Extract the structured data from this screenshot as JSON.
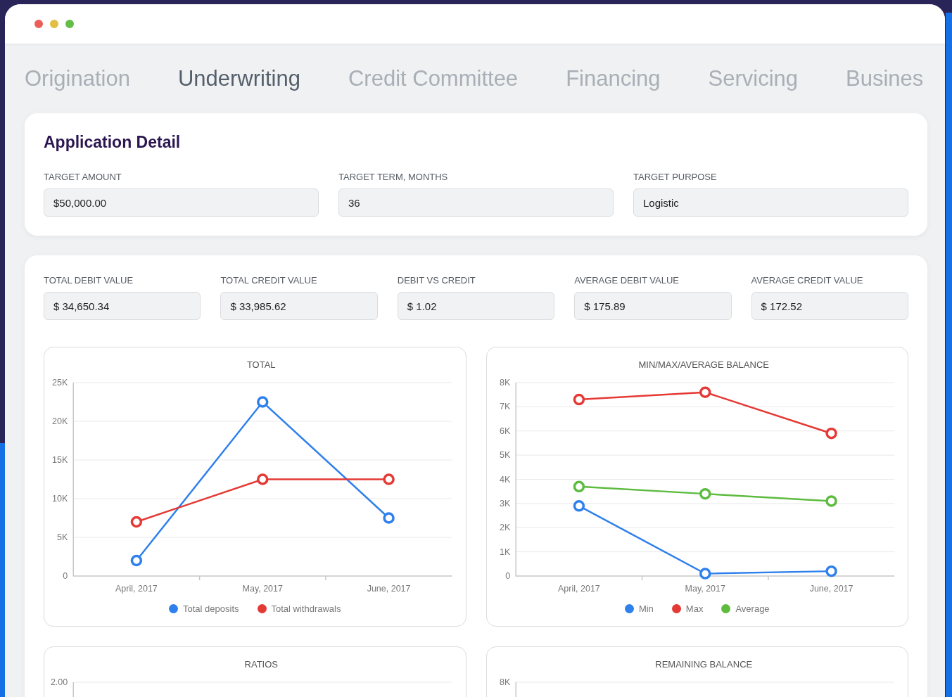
{
  "window_controls": [
    {
      "color": "#ec5f58"
    },
    {
      "color": "#e2bf40"
    },
    {
      "color": "#64bd46"
    }
  ],
  "tabs": [
    {
      "label": "Origination",
      "selected": false
    },
    {
      "label": "Underwriting",
      "selected": true
    },
    {
      "label": "Credit Committee",
      "selected": false
    },
    {
      "label": "Financing",
      "selected": false
    },
    {
      "label": "Servicing",
      "selected": false
    },
    {
      "label": "Busines",
      "selected": false
    }
  ],
  "application_detail": {
    "title": "Application Detail",
    "fields": [
      {
        "label": "TARGET AMOUNT",
        "value": "$50,000.00"
      },
      {
        "label": "TARGET TERM, MONTHS",
        "value": "36"
      },
      {
        "label": "TARGET PURPOSE",
        "value": "Logistic"
      }
    ]
  },
  "summary": {
    "fields": [
      {
        "label": "TOTAL DEBIT VALUE",
        "value": "$ 34,650.34"
      },
      {
        "label": "TOTAL CREDIT VALUE",
        "value": "$ 33,985.62"
      },
      {
        "label": "DEBIT VS CREDIT",
        "value": "$ 1.02"
      },
      {
        "label": "AVERAGE DEBIT VALUE",
        "value": "$ 175.89"
      },
      {
        "label": "AVERAGE CREDIT VALUE",
        "value": "$ 172.52"
      }
    ]
  },
  "charts": [
    {
      "chart_data": {
        "type": "line",
        "title": "TOTAL",
        "grid": true,
        "legend": "bottom",
        "categories": [
          "April, 2017",
          "May, 2017",
          "June, 2017"
        ],
        "ylim": [
          0,
          25000
        ],
        "yticks": [
          {
            "value": 0,
            "label": "0"
          },
          {
            "value": 5000,
            "label": "5K"
          },
          {
            "value": 10000,
            "label": "10K"
          },
          {
            "value": 15000,
            "label": "15K"
          },
          {
            "value": 20000,
            "label": "20K"
          },
          {
            "value": 25000,
            "label": "25K"
          }
        ],
        "series": [
          {
            "name": "Total deposits",
            "color": "#2f80ed",
            "marker": "circle",
            "values": [
              2000,
              22500,
              7500
            ]
          },
          {
            "name": "Total withdrawals",
            "color": "#e53935",
            "marker": "circle",
            "values": [
              7000,
              12500,
              12500
            ]
          }
        ]
      }
    },
    {
      "chart_data": {
        "type": "line",
        "title": "MIN/MAX/AVERAGE BALANCE",
        "grid": true,
        "legend": "bottom",
        "categories": [
          "April, 2017",
          "May, 2017",
          "June, 2017"
        ],
        "ylim": [
          0,
          8000
        ],
        "yticks": [
          {
            "value": 0,
            "label": "0"
          },
          {
            "value": 1000,
            "label": "1K"
          },
          {
            "value": 2000,
            "label": "2K"
          },
          {
            "value": 3000,
            "label": "3K"
          },
          {
            "value": 4000,
            "label": "4K"
          },
          {
            "value": 5000,
            "label": "5K"
          },
          {
            "value": 6000,
            "label": "6K"
          },
          {
            "value": 7000,
            "label": "7K"
          },
          {
            "value": 8000,
            "label": "8K"
          }
        ],
        "series": [
          {
            "name": "Min",
            "color": "#2f80ed",
            "marker": "circle",
            "values": [
              2900,
              100,
              200
            ]
          },
          {
            "name": "Max",
            "color": "#e53935",
            "marker": "circle",
            "values": [
              7300,
              7600,
              5900
            ]
          },
          {
            "name": "Average",
            "color": "#5dbb3f",
            "marker": "circle",
            "values": [
              3700,
              3400,
              3100
            ]
          }
        ]
      }
    }
  ],
  "more_charts": [
    {
      "title": "RATIOS",
      "top_tick": "2.00"
    },
    {
      "title": "REMAINING BALANCE",
      "top_tick": "8K"
    }
  ]
}
